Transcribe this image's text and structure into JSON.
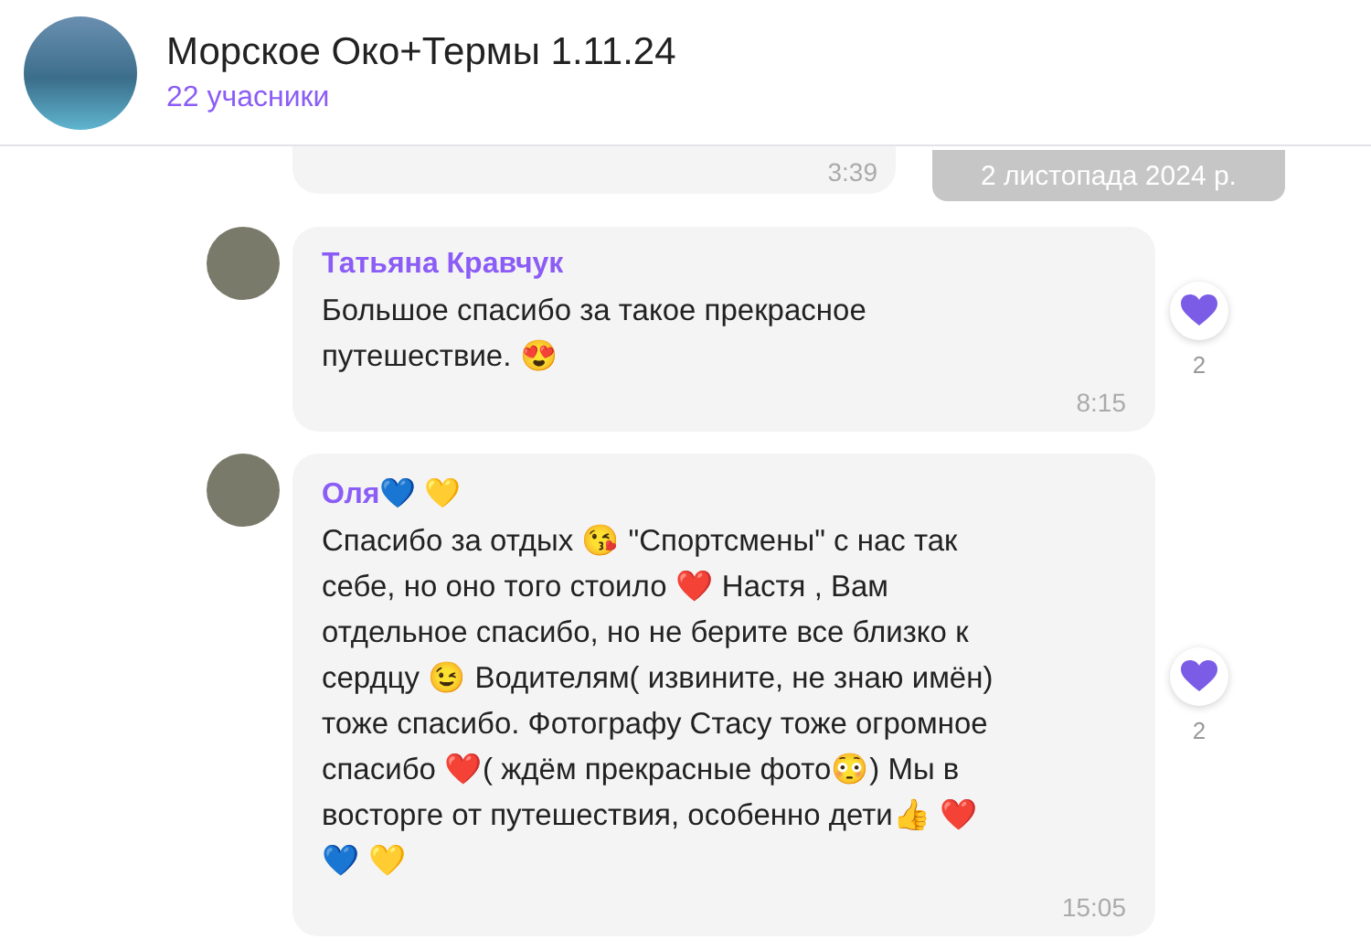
{
  "header": {
    "title": "Морское Око+Термы 1.11.24",
    "subtitle": "22 учасники"
  },
  "date_pill": "2 листопада 2024 р.",
  "previous_message": {
    "time": "3:39"
  },
  "messages": [
    {
      "author": "Татьяна Кравчук",
      "text": "Большое спасибо за такое прекрасное путешествие. 😍",
      "time": "8:15",
      "reaction": {
        "count": "2"
      }
    },
    {
      "author": "Оля💙 💛",
      "text": "Спасибо за отдых 😘 \"Спортсмены\" с нас так себе, но оно того стоило ❤️ Настя , Вам отдельное спасибо, но не берите все близко к сердцу 😉 Водителям( извините, не знаю имён) тоже спасибо. Фотографу Стасу тоже огромное спасибо ❤️( ждём прекрасные фото😳) Мы в восторге от путешествия, особенно дети👍 ❤️ 💙 💛",
      "time": "15:05",
      "reaction": {
        "count": "2"
      }
    }
  ]
}
